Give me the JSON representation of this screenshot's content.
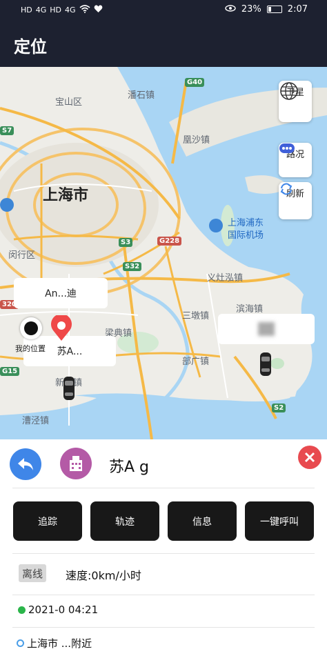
{
  "status_bar": {
    "left": [
      "HD",
      "4G",
      "HD",
      "4G"
    ],
    "battery": "23%",
    "time": "2:07"
  },
  "app_bar": {
    "title": "定位"
  },
  "map": {
    "labels": {
      "baoshan": "宝山区",
      "luodian_zhen": "潘石镇",
      "gaoqiao_zhen": "凰沙镇",
      "shanghai": "上海市",
      "minhang": "闵行区",
      "airport_1": "上海浦东",
      "airport_2": "国际机场",
      "yizao": "义灶泓镇",
      "binhai": "滨海镇",
      "sandun": "三墩镇",
      "liangdian": "梁典镇",
      "bugan": "部广镇",
      "xinzhen": "新一镇",
      "caojing": "漕泾镇"
    },
    "shields": {
      "g40": "G40",
      "s7": "S7",
      "s3": "S3",
      "g228": "G228",
      "s32": "S32",
      "g15": "G15",
      "s2": "S2",
      "b320": "320"
    },
    "buttons": {
      "satellite": "卫星",
      "traffic": "路况",
      "refresh": "刷新"
    },
    "markers": {
      "my_location": "我的位置",
      "bubble_1": "An...迪",
      "bubble_2": "苏A..."
    }
  },
  "panel": {
    "vehicle_name": "苏A  g",
    "actions": [
      "追踪",
      "轨迹",
      "信息",
      "一键呼叫"
    ],
    "status_tag": "离线",
    "speed": "速度:0km/小时",
    "time": "2021-0     04:21",
    "address": "上海市        ...附近"
  },
  "colors": {
    "header": "#1d2130",
    "primary_button": "#3f86e8",
    "close_button": "#e84a4f",
    "action_button": "#181818",
    "online_dot": "#2bb54a"
  }
}
